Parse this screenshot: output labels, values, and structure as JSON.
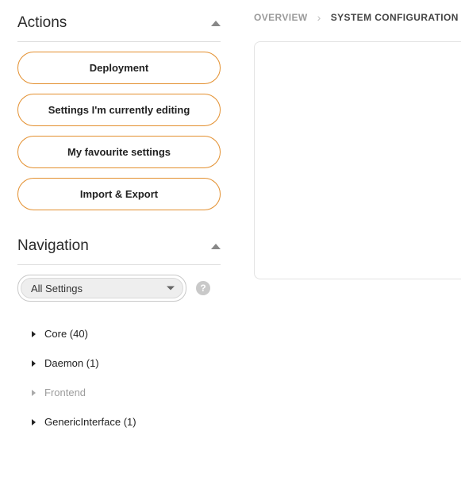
{
  "breadcrumbs": {
    "overview": "OVERVIEW",
    "current": "SYSTEM CONFIGURATION"
  },
  "actions": {
    "title": "Actions",
    "buttons": {
      "deployment": "Deployment",
      "editing": "Settings I'm currently editing",
      "favourites": "My favourite settings",
      "import_export": "Import & Export"
    }
  },
  "navigation": {
    "title": "Navigation",
    "select_label": "All Settings",
    "help_glyph": "?",
    "tree": {
      "core": "Core (40)",
      "daemon": "Daemon (1)",
      "frontend": "Frontend",
      "generic_interface": "GenericInterface (1)"
    }
  }
}
